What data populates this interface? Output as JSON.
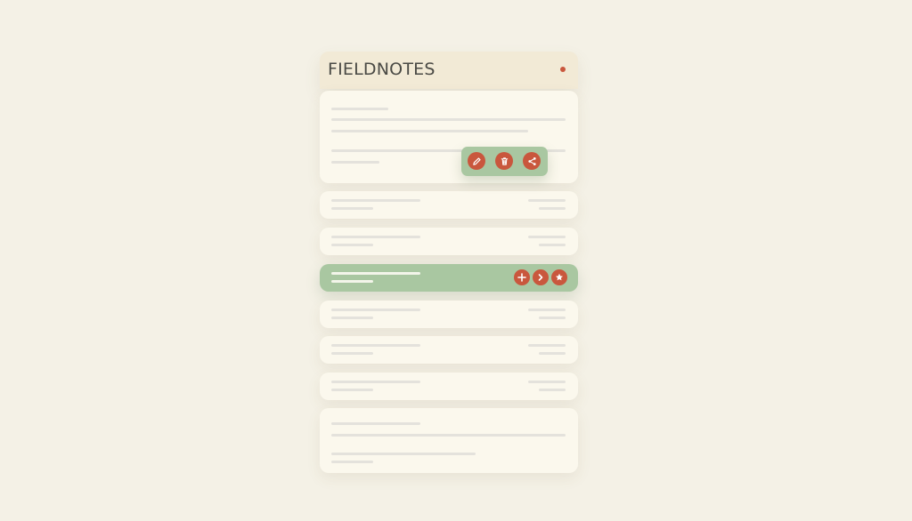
{
  "app": {
    "title": "FIELDNOTES"
  },
  "icons": {
    "note_actions": [
      "pencil-icon",
      "trash-icon",
      "share-icon"
    ],
    "row_actions": [
      "plus-icon",
      "chevron-right-icon",
      "star-icon"
    ]
  },
  "colors": {
    "background": "#f4f1e6",
    "card": "#fbf8ed",
    "header": "#f2ead6",
    "accent_green": "#a9c7a1",
    "accent_red": "#c9573d",
    "placeholder_line": "#e4e2dc"
  }
}
